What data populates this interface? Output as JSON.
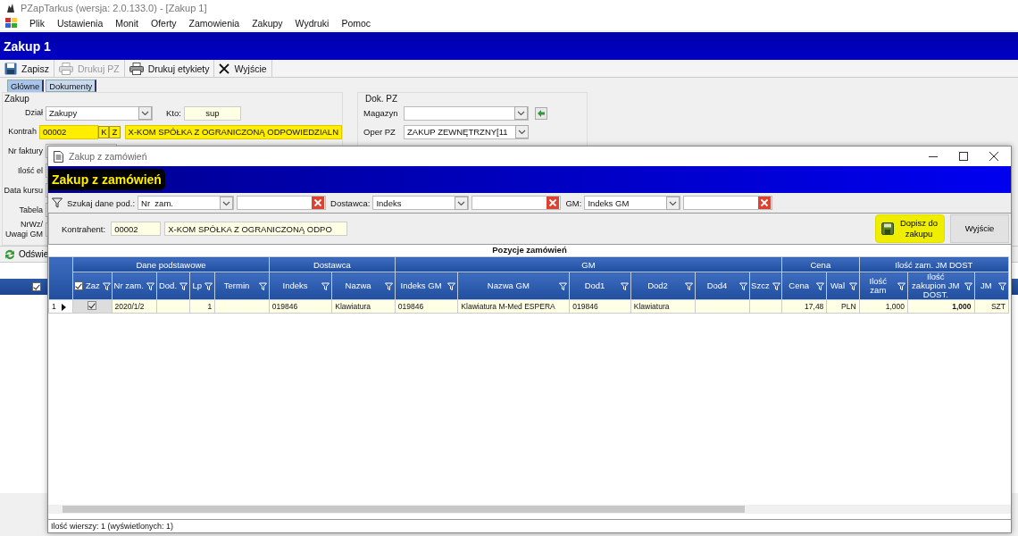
{
  "window": {
    "title": "PZapTarkus (wersja: 2.0.133.0) - [Zakup 1]"
  },
  "menu": [
    "Plik",
    "Ustawienia",
    "Monit",
    "Oferty",
    "Zamowienia",
    "Zakupy",
    "Wydruki",
    "Pomoc"
  ],
  "document_title": "Zakup 1",
  "toolbar": [
    {
      "label": "Zapisz",
      "kind": "save",
      "disabled": false
    },
    {
      "label": "Drukuj PZ",
      "kind": "print",
      "disabled": true
    },
    {
      "label": "Drukuj etykiety",
      "kind": "print",
      "disabled": false
    },
    {
      "label": "Wyjście",
      "kind": "exit",
      "disabled": false
    }
  ],
  "tabs": [
    {
      "label": "Główne",
      "selected": true
    },
    {
      "label": "Dokumenty",
      "selected": false
    }
  ],
  "zakup": {
    "title": "Zakup",
    "dzial_label": "Dział",
    "dzial_value": "Zakupy",
    "kto_label": "Kto:",
    "kto_value": "sup",
    "kontrah_label": "Kontrah",
    "kontrah_code": "00002",
    "kontrah_buttons": [
      "K",
      "Z"
    ],
    "kontrah_name": "X-KOM SPÓŁKA Z OGRANICZONĄ ODPOWIEDZIALN",
    "labels": [
      "Nr faktury",
      "Ilość el",
      "Data kursu",
      "Tabela",
      "NrWz/\nUwagi GM"
    ]
  },
  "dok_pz": {
    "title": "Dok. PZ",
    "magazyn_label": "Magazyn",
    "oper_label": "Oper PZ",
    "oper_value": "ZAKUP ZEWNĘTRZNY",
    "oper_code": "[11"
  },
  "refresh_label": "Odświe",
  "back_grid": {
    "all_checked": true
  },
  "dialog": {
    "title": "Zakup z zamówień",
    "header": "Zakup z zamówień",
    "header_highlighted": true,
    "filters": [
      {
        "label": "Szukaj dane pod.:",
        "choice": "Nr  zam."
      },
      {
        "label": "Dostawca:",
        "choice": "Indeks"
      },
      {
        "label": "GM:",
        "choice": "Indeks GM"
      }
    ],
    "kontrahent_label": "Kontrahent:",
    "kontrahent_code": "00002",
    "kontrahent_name": "X-KOM SPÓŁKA Z OGRANICZONĄ ODPO",
    "buttons": [
      {
        "label": "Dopisz do zakupu",
        "kind": "save",
        "highlighted": true
      },
      {
        "label": "Wyjście",
        "kind": "plain",
        "highlighted": false
      }
    ],
    "grid": {
      "title": "Pozycje zamówień",
      "groups": [
        {
          "label": "Dane podstawowe",
          "columns": [
            {
              "label": "Zaz",
              "kind": "check",
              "all_checked": true
            },
            {
              "label": "Nr zam.",
              "kind": "text"
            },
            {
              "label": "Dod.",
              "kind": "text"
            },
            {
              "label": "Lp",
              "kind": "number"
            },
            {
              "label": "Termin",
              "kind": "text"
            }
          ]
        },
        {
          "label": "Dostawca",
          "columns": [
            {
              "label": "Indeks",
              "kind": "text"
            },
            {
              "label": "Nazwa",
              "kind": "text"
            }
          ]
        },
        {
          "label": "GM",
          "columns": [
            {
              "label": "Indeks GM",
              "kind": "text"
            },
            {
              "label": "Nazwa GM",
              "kind": "text"
            },
            {
              "label": "Dod1",
              "kind": "text"
            },
            {
              "label": "Dod2",
              "kind": "text"
            },
            {
              "label": "Dod4",
              "kind": "text"
            },
            {
              "label": "Szcz",
              "kind": "text"
            }
          ]
        },
        {
          "label": "Cena",
          "columns": [
            {
              "label": "Cena",
              "kind": "number"
            },
            {
              "label": "Wal",
              "kind": "number"
            }
          ]
        },
        {
          "label": "Ilość zam. JM DOST",
          "columns": [
            {
              "label": "Ilość zam",
              "kind": "number"
            },
            {
              "label": "Ilość zakupion JM DOST.",
              "kind": "bold_number"
            },
            {
              "label": "JM",
              "kind": "number"
            }
          ]
        }
      ],
      "rows": [
        {
          "number": "1",
          "current": true,
          "checked": true,
          "cells": [
            "",
            "2020/1/2",
            "",
            "1",
            "",
            "019846",
            "Klawiatura",
            "019846",
            "Klawiatura M-Med ESPERA",
            "019846",
            "Klawiatura",
            "",
            "",
            "17,48",
            "PLN",
            "1,000",
            "1,000",
            "SZT"
          ]
        }
      ]
    },
    "status": "Ilość wierszy: 1 (wyświetlonych: 1)"
  }
}
